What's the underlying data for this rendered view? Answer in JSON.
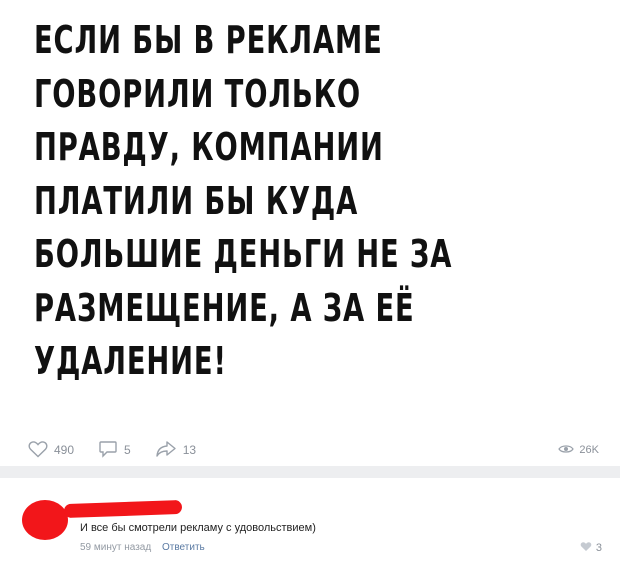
{
  "post": {
    "text": "ЕСЛИ БЫ В РЕКЛАМЕ ГОВОРИЛИ ТОЛЬКО ПРАВДУ, КОМПАНИИ ПЛАТИЛИ БЫ КУДА БОЛЬШИЕ ДЕНЬГИ НЕ ЗА РАЗМЕЩЕНИЕ, А ЗА ЕЁ УДАЛЕНИЕ!",
    "lines": [
      "ЕСЛИ БЫ В РЕКЛАМЕ",
      "ГОВОРИЛИ ТОЛЬКО",
      "ПРАВДУ, КОМПАНИИ",
      "ПЛАТИЛИ БЫ КУДА",
      "БОЛЬШИЕ ДЕНЬГИ НЕ ЗА",
      "РАЗМЕЩЕНИЕ, А ЗА ЕЁ",
      "УДАЛЕНИЕ!"
    ],
    "likes": "490",
    "comments": "5",
    "shares": "13",
    "views": "26K"
  },
  "comment": {
    "text": "И все бы смотрели рекламу с удовольствием)",
    "time": "59 минут назад",
    "reply_label": "Ответить",
    "likes": "3"
  },
  "icons": {
    "like": "heart-icon",
    "comment": "comment-icon",
    "share": "share-arrow-icon",
    "views": "eye-icon"
  },
  "colors": {
    "redaction": "#f2161a",
    "meta": "#8a9099",
    "link": "#5a7aa3"
  }
}
